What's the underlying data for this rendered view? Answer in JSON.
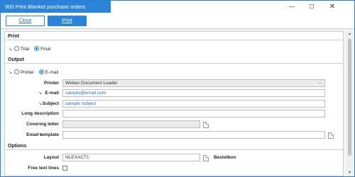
{
  "window": {
    "title": "500 Print Blanket purchase orders"
  },
  "window_controls": {
    "minimize": "—",
    "maximize": "☐",
    "close": "✕"
  },
  "toolbar": {
    "close_label": "Close",
    "print_label": "Print"
  },
  "sections": {
    "print": {
      "title": "Print",
      "options": [
        "Trial",
        "Final"
      ],
      "selected": "Final"
    },
    "output": {
      "title": "Output",
      "options": [
        "Printer",
        "E-mail"
      ],
      "selected": "E-mail",
      "fields": {
        "printer": {
          "label": "Printer",
          "value": "Webex Document Loader"
        },
        "email": {
          "label": "E-mail",
          "value": "sample@email.com"
        },
        "subject": {
          "label": "Subject",
          "value": "sample subject"
        },
        "long_description": {
          "label": "Long description",
          "value": ""
        },
        "covering_letter": {
          "label": "Covering letter",
          "value": ""
        },
        "email_template": {
          "label": "Email template",
          "value": ""
        }
      }
    },
    "options": {
      "title": "Options",
      "layout": {
        "label": "Layout",
        "value": "NLEXACT1",
        "description": "Bestelbon"
      },
      "free_text_lines": {
        "label": "Free text lines",
        "checked": false
      }
    }
  },
  "icons": {
    "required_marker": "↘",
    "select_chevron": "⌄",
    "scroll_up": "▲",
    "scroll_down": "▼"
  },
  "colors": {
    "accent": "#2c84d9",
    "link_text": "#2c6ec4"
  }
}
